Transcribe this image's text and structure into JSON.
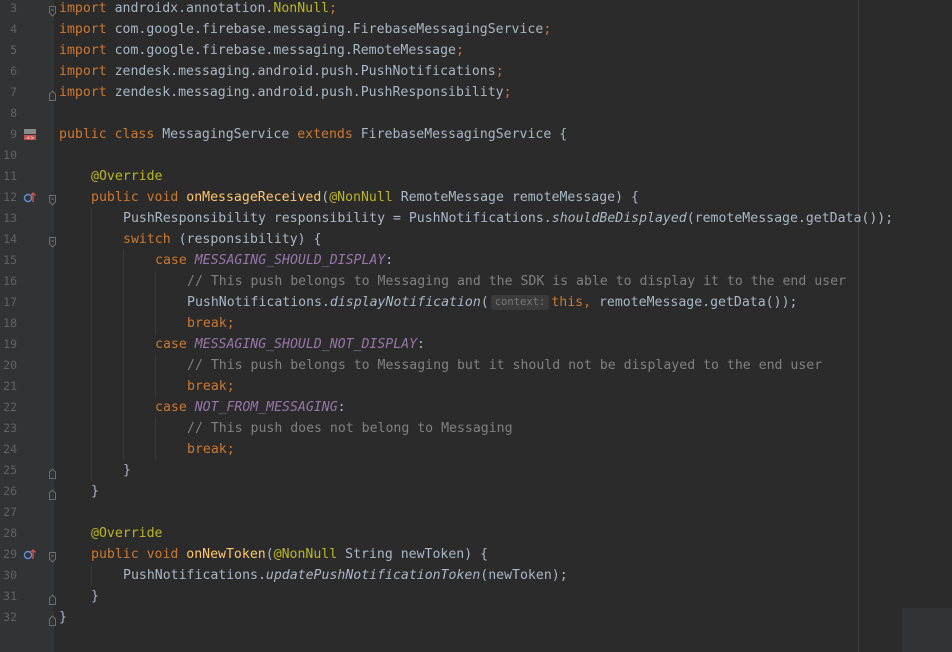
{
  "colors": {
    "background": "#2b2b2b",
    "gutter": "#313335",
    "keyword": "#cc7832",
    "annotation": "#bbb529",
    "method": "#ffc66d",
    "static_field": "#9876aa",
    "comment": "#808080",
    "plain": "#a9b7c6"
  },
  "lines": [
    {
      "n": "3",
      "fold": "start",
      "tokens": [
        [
          "kw",
          "import"
        ],
        [
          "p",
          " androidx.annotation."
        ],
        [
          "ann",
          "NonNull"
        ],
        [
          "kw",
          ";"
        ]
      ]
    },
    {
      "n": "4",
      "tokens": [
        [
          "kw",
          "import"
        ],
        [
          "p",
          " com.google.firebase.messaging.FirebaseMessagingService"
        ],
        [
          "kw",
          ";"
        ]
      ]
    },
    {
      "n": "5",
      "tokens": [
        [
          "kw",
          "import"
        ],
        [
          "p",
          " com.google.firebase.messaging.RemoteMessage"
        ],
        [
          "kw",
          ";"
        ]
      ]
    },
    {
      "n": "6",
      "tokens": [
        [
          "kw",
          "import"
        ],
        [
          "p",
          " zendesk.messaging.android.push.PushNotifications"
        ],
        [
          "kw",
          ";"
        ]
      ]
    },
    {
      "n": "7",
      "fold": "end",
      "tokens": [
        [
          "kw",
          "import"
        ],
        [
          "p",
          " zendesk.messaging.android.push.PushResponsibility"
        ],
        [
          "kw",
          ";"
        ]
      ]
    },
    {
      "n": "8",
      "tokens": []
    },
    {
      "n": "9",
      "icon": "class-icon",
      "tokens": [
        [
          "kw",
          "public class"
        ],
        [
          "p",
          " MessagingService "
        ],
        [
          "kw",
          "extends"
        ],
        [
          "p",
          " FirebaseMessagingService {"
        ]
      ]
    },
    {
      "n": "10",
      "tokens": []
    },
    {
      "n": "11",
      "indent": 1,
      "tokens": [
        [
          "ann",
          "@Override"
        ]
      ]
    },
    {
      "n": "12",
      "icon": "override-icon",
      "fold": "start",
      "indent": 1,
      "tokens": [
        [
          "kw",
          "public void"
        ],
        [
          "p",
          " "
        ],
        [
          "fn",
          "onMessageReceived"
        ],
        [
          "p",
          "("
        ],
        [
          "ann",
          "@NonNull"
        ],
        [
          "p",
          " RemoteMessage remoteMessage) {"
        ]
      ]
    },
    {
      "n": "13",
      "indent": 2,
      "tokens": [
        [
          "p",
          "PushResponsibility responsibility = PushNotifications."
        ],
        [
          "it",
          "shouldBeDisplayed"
        ],
        [
          "p",
          "(remoteMessage.getData());"
        ]
      ]
    },
    {
      "n": "14",
      "fold": "start",
      "indent": 2,
      "tokens": [
        [
          "kw",
          "switch"
        ],
        [
          "p",
          " (responsibility) {"
        ]
      ]
    },
    {
      "n": "15",
      "indent": 3,
      "tokens": [
        [
          "kw",
          "case"
        ],
        [
          "p",
          " "
        ],
        [
          "sf",
          "MESSAGING_SHOULD_DISPLAY"
        ],
        [
          "p",
          ":"
        ]
      ]
    },
    {
      "n": "16",
      "indent": 4,
      "tokens": [
        [
          "cm",
          "// This push belongs to Messaging and the SDK is able to display it to the end user"
        ]
      ]
    },
    {
      "n": "17",
      "indent": 4,
      "tokens": [
        [
          "p",
          "PushNotifications."
        ],
        [
          "it",
          "displayNotification"
        ],
        [
          "p",
          "("
        ],
        [
          "hint",
          "context:"
        ],
        [
          "kw",
          "this,"
        ],
        [
          "p",
          " remoteMessage.getData());"
        ]
      ]
    },
    {
      "n": "18",
      "indent": 4,
      "tokens": [
        [
          "kw",
          "break;"
        ]
      ]
    },
    {
      "n": "19",
      "indent": 3,
      "tokens": [
        [
          "kw",
          "case"
        ],
        [
          "p",
          " "
        ],
        [
          "sf",
          "MESSAGING_SHOULD_NOT_DISPLAY"
        ],
        [
          "p",
          ":"
        ]
      ]
    },
    {
      "n": "20",
      "indent": 4,
      "tokens": [
        [
          "cm",
          "// This push belongs to Messaging but it should not be displayed to the end user"
        ]
      ]
    },
    {
      "n": "21",
      "indent": 4,
      "tokens": [
        [
          "kw",
          "break;"
        ]
      ]
    },
    {
      "n": "22",
      "indent": 3,
      "tokens": [
        [
          "kw",
          "case"
        ],
        [
          "p",
          " "
        ],
        [
          "sf",
          "NOT_FROM_MESSAGING"
        ],
        [
          "p",
          ":"
        ]
      ]
    },
    {
      "n": "23",
      "indent": 4,
      "tokens": [
        [
          "cm",
          "// This push does not belong to Messaging"
        ]
      ]
    },
    {
      "n": "24",
      "indent": 4,
      "tokens": [
        [
          "kw",
          "break;"
        ]
      ]
    },
    {
      "n": "25",
      "fold": "end",
      "indent": 2,
      "tokens": [
        [
          "p",
          "}"
        ]
      ]
    },
    {
      "n": "26",
      "fold": "end",
      "indent": 1,
      "tokens": [
        [
          "p",
          "}"
        ]
      ]
    },
    {
      "n": "27",
      "tokens": []
    },
    {
      "n": "28",
      "indent": 1,
      "tokens": [
        [
          "ann",
          "@Override"
        ]
      ]
    },
    {
      "n": "29",
      "icon": "override-icon",
      "fold": "start",
      "indent": 1,
      "tokens": [
        [
          "kw",
          "public void"
        ],
        [
          "p",
          " "
        ],
        [
          "fn",
          "onNewToken"
        ],
        [
          "p",
          "("
        ],
        [
          "ann",
          "@NonNull"
        ],
        [
          "p",
          " String newToken) {"
        ]
      ]
    },
    {
      "n": "30",
      "indent": 2,
      "tokens": [
        [
          "p",
          "PushNotifications."
        ],
        [
          "it",
          "updatePushNotificationToken"
        ],
        [
          "p",
          "(newToken);"
        ]
      ]
    },
    {
      "n": "31",
      "fold": "end",
      "indent": 1,
      "tokens": [
        [
          "p",
          "}"
        ]
      ]
    },
    {
      "n": "32",
      "fold": "end",
      "tokens": [
        [
          "p",
          "}"
        ]
      ]
    }
  ]
}
